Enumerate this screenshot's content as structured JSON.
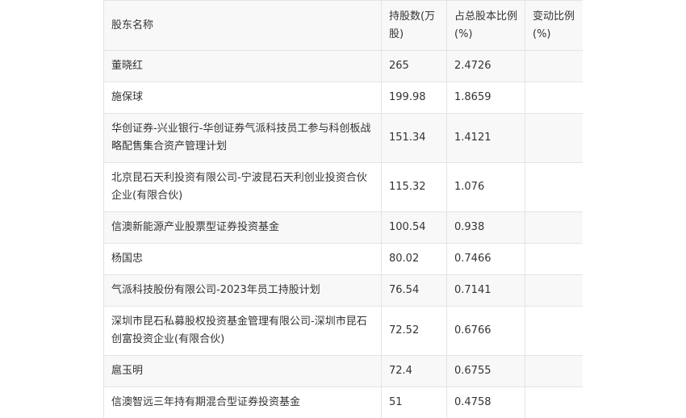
{
  "table": {
    "headers": [
      "股东名称",
      "持股数(万股)",
      "占总股本比例(%)",
      "变动比例(%)"
    ],
    "rows": [
      {
        "name": "董晓红",
        "shares": "265",
        "ratio": "2.4726",
        "change": ""
      },
      {
        "name": "施保球",
        "shares": "199.98",
        "ratio": "1.8659",
        "change": ""
      },
      {
        "name": "华创证券-兴业银行-华创证券气派科技员工参与科创板战略配售集合资产管理计划",
        "shares": "151.34",
        "ratio": "1.4121",
        "change": ""
      },
      {
        "name": "北京昆石天利投资有限公司-宁波昆石天利创业投资合伙企业(有限合伙)",
        "shares": "115.32",
        "ratio": "1.076",
        "change": ""
      },
      {
        "name": "信澳新能源产业股票型证券投资基金",
        "shares": "100.54",
        "ratio": "0.938",
        "change": ""
      },
      {
        "name": "杨国忠",
        "shares": "80.02",
        "ratio": "0.7466",
        "change": ""
      },
      {
        "name": "气派科技股份有限公司-2023年员工持股计划",
        "shares": "76.54",
        "ratio": "0.7141",
        "change": ""
      },
      {
        "name": "深圳市昆石私募股权投资基金管理有限公司-深圳市昆石创富投资企业(有限合伙)",
        "shares": "72.52",
        "ratio": "0.6766",
        "change": ""
      },
      {
        "name": "扈玉明",
        "shares": "72.4",
        "ratio": "0.6755",
        "change": ""
      },
      {
        "name": "信澳智远三年持有期混合型证券投资基金",
        "shares": "51",
        "ratio": "0.4758",
        "change": ""
      }
    ]
  }
}
